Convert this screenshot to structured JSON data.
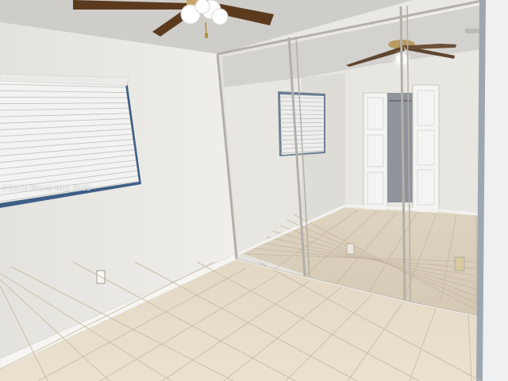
{
  "photo": {
    "watermark_text": "©2025 Miami MLS 2025"
  },
  "palette": {
    "wall": "#eceae6",
    "wall_shadow": "#dddbd6",
    "ceiling": "#cfcdca",
    "floor": "#e6dcc8",
    "grout": "#c9bda7",
    "baseboard": "#f4f3ef",
    "mirror_tint": "#d7d3cc",
    "frame": "#bdbab4",
    "blind": "#f2f2f0",
    "window_frame": "#3f5f86",
    "fan_blade": "#5b3a1e"
  }
}
